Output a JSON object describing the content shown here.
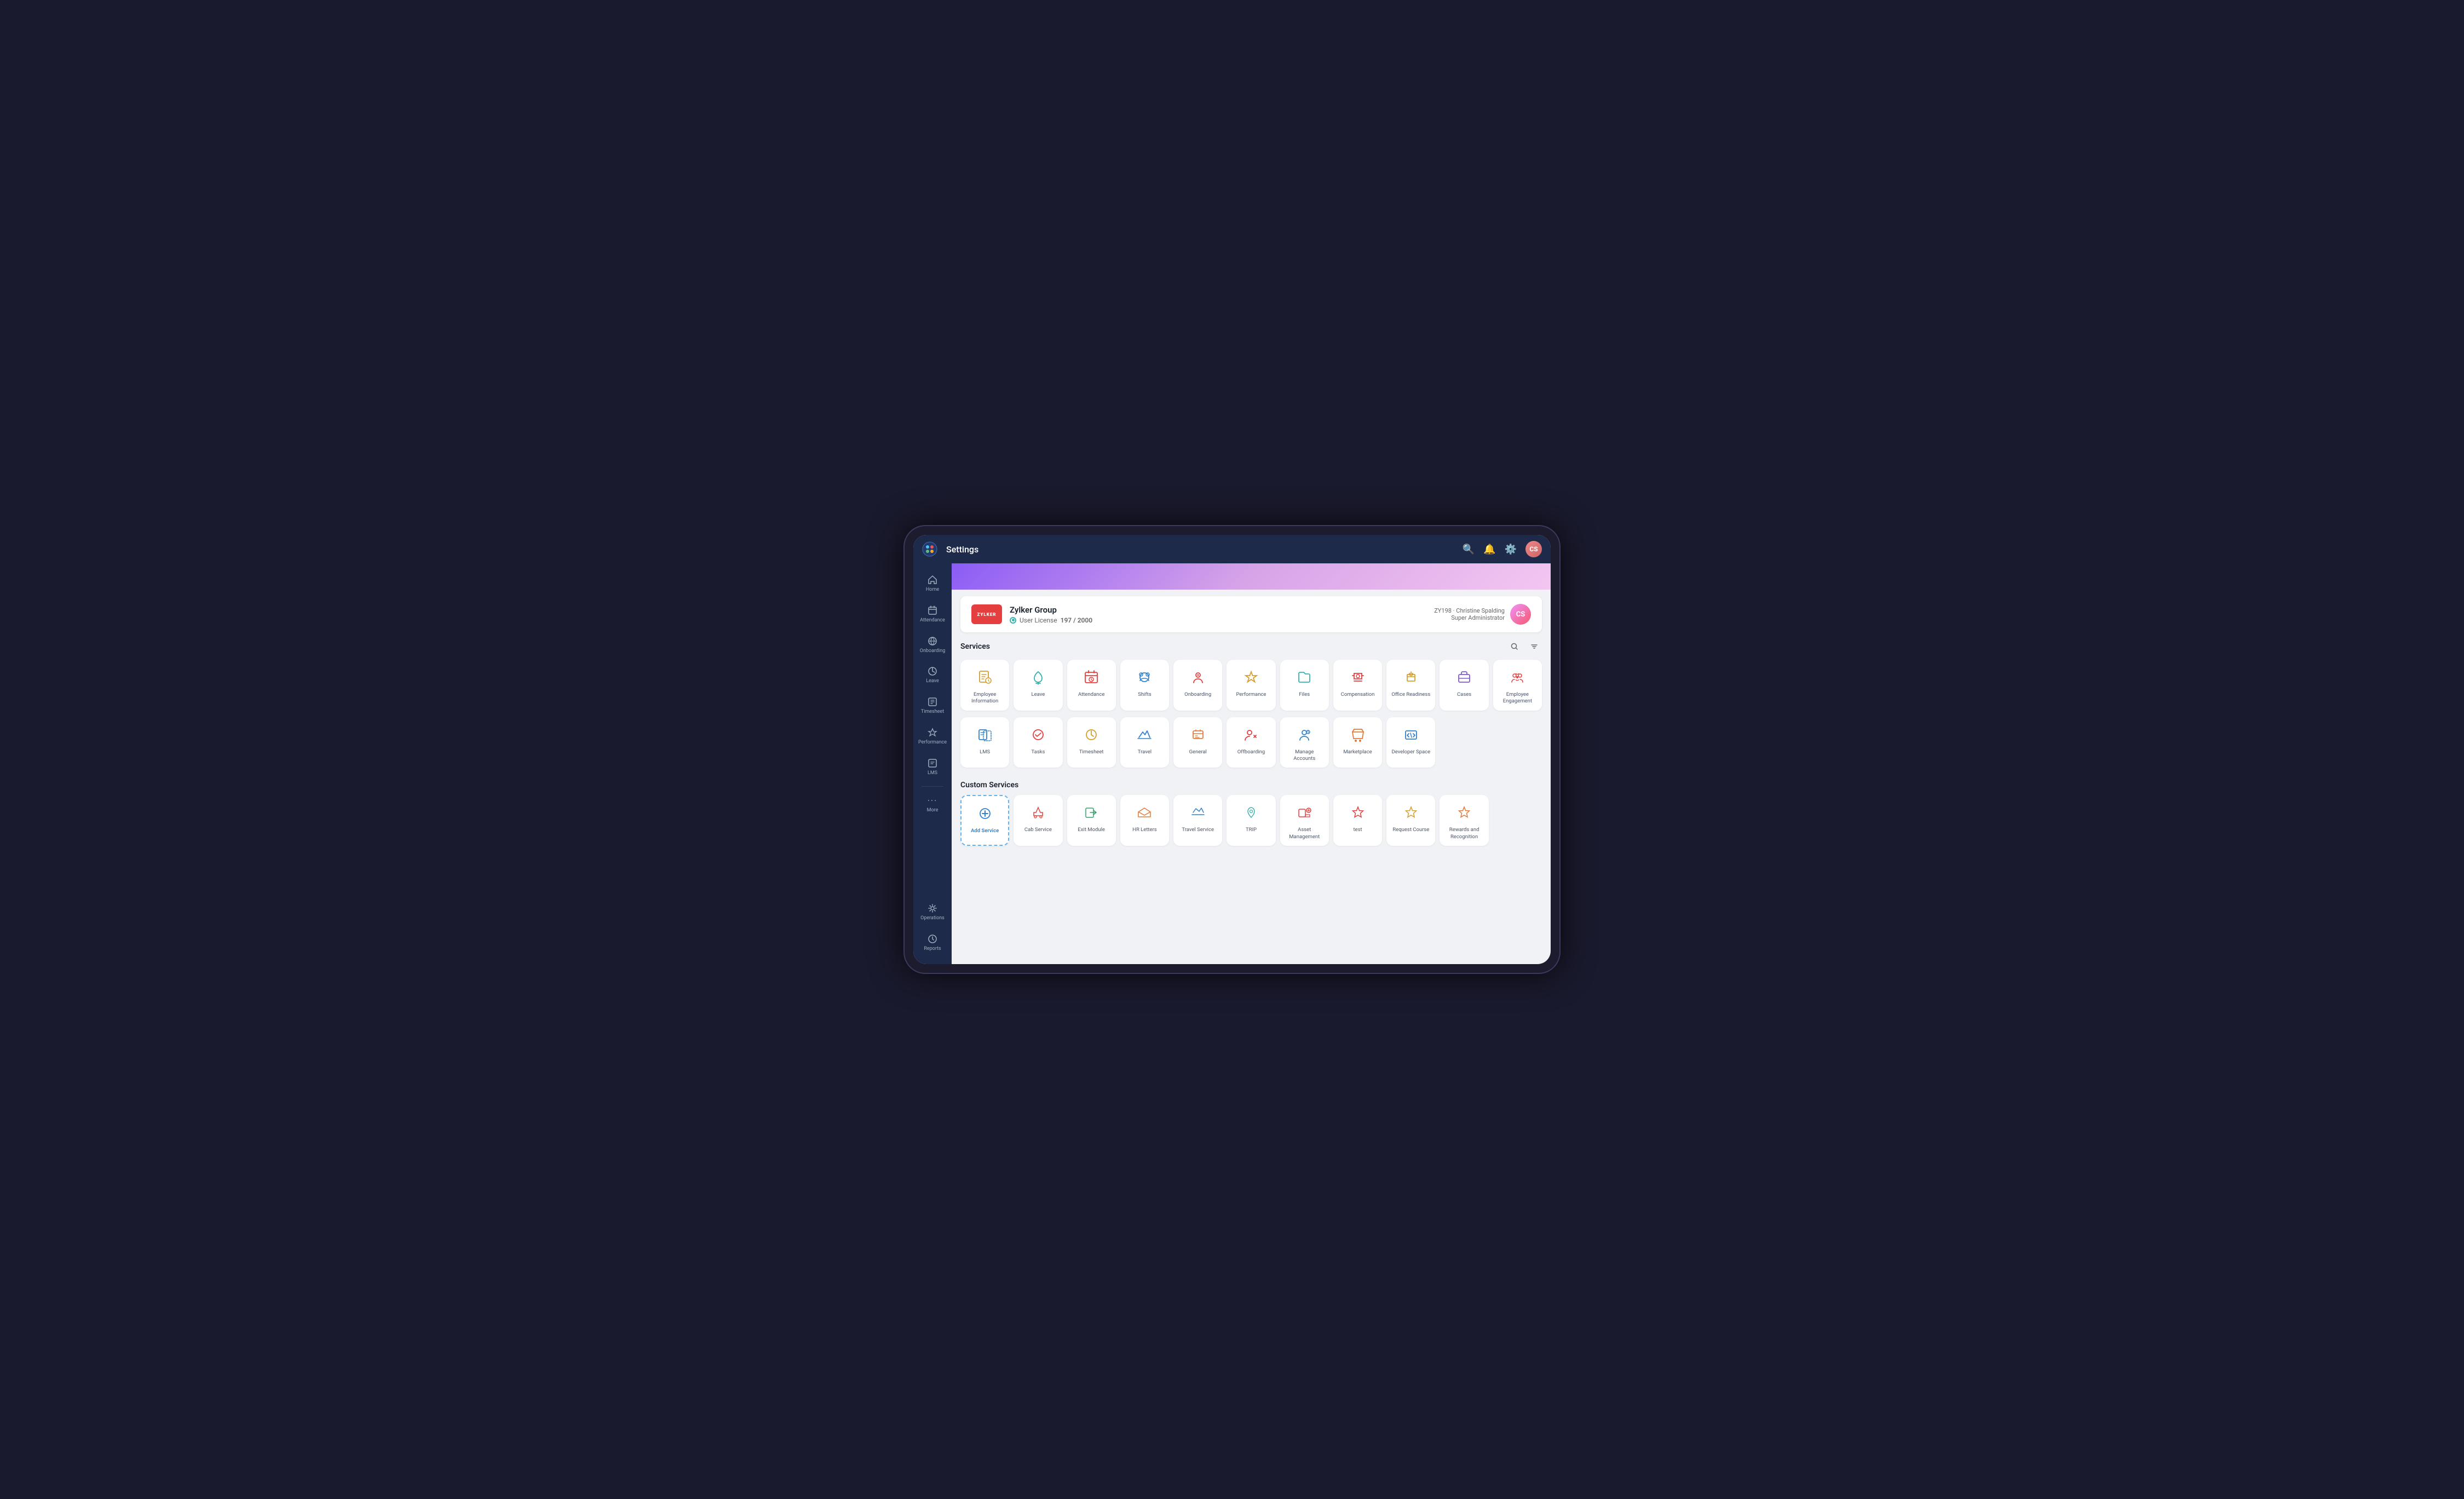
{
  "topBar": {
    "title": "Settings",
    "logoAlt": "Zoho People Logo"
  },
  "sidebar": {
    "items": [
      {
        "id": "home",
        "label": "Home",
        "icon": "🏠"
      },
      {
        "id": "attendance",
        "label": "Attendance",
        "icon": "📅"
      },
      {
        "id": "onboarding",
        "label": "Onboarding",
        "icon": "🌐"
      },
      {
        "id": "leave",
        "label": "Leave",
        "icon": "🌴"
      },
      {
        "id": "timesheet",
        "label": "Timesheet",
        "icon": "⏱"
      },
      {
        "id": "performance",
        "label": "Performance",
        "icon": "🏆"
      },
      {
        "id": "lms",
        "label": "LMS",
        "icon": "📋"
      },
      {
        "id": "more",
        "label": "More",
        "icon": "•••"
      },
      {
        "id": "operations",
        "label": "Operations",
        "icon": "⚙"
      },
      {
        "id": "reports",
        "label": "Reports",
        "icon": "🕐"
      }
    ]
  },
  "company": {
    "logo": "ZYLKER",
    "name": "Zylker Group",
    "license_label": "User License",
    "license_used": "197",
    "license_total": "2000"
  },
  "user": {
    "id": "ZY198",
    "name": "Christine Spalding",
    "role": "Super Administrator"
  },
  "services": {
    "section_title": "Services",
    "items": [
      {
        "id": "employee-information",
        "label": "Employee\nInformation",
        "color": "#d69e2e"
      },
      {
        "id": "leave",
        "label": "Leave",
        "color": "#38b2ac"
      },
      {
        "id": "attendance",
        "label": "Attendance",
        "color": "#e53e3e"
      },
      {
        "id": "shifts",
        "label": "Shifts",
        "color": "#3182ce"
      },
      {
        "id": "onboarding",
        "label": "Onboarding",
        "color": "#e53e3e"
      },
      {
        "id": "performance",
        "label": "Performance",
        "color": "#d69e2e"
      },
      {
        "id": "files",
        "label": "Files",
        "color": "#38b2ac"
      },
      {
        "id": "compensation",
        "label": "Compensation",
        "color": "#e53e3e"
      },
      {
        "id": "office-readiness",
        "label": "Office Readiness",
        "color": "#d69e2e"
      },
      {
        "id": "cases",
        "label": "Cases",
        "color": "#805ad5"
      },
      {
        "id": "employee-engagement",
        "label": "Employee\nEngagement",
        "color": "#e53e3e"
      },
      {
        "id": "lms",
        "label": "LMS",
        "color": "#3182ce"
      },
      {
        "id": "tasks",
        "label": "Tasks",
        "color": "#e53e3e"
      },
      {
        "id": "timesheet",
        "label": "Timesheet",
        "color": "#d69e2e"
      },
      {
        "id": "travel",
        "label": "Travel",
        "color": "#3182ce"
      },
      {
        "id": "general",
        "label": "General",
        "color": "#e07b39"
      },
      {
        "id": "offboarding",
        "label": "Offboarding",
        "color": "#e53e3e"
      },
      {
        "id": "manage-accounts",
        "label": "Manage Accounts",
        "color": "#3182ce"
      },
      {
        "id": "marketplace",
        "label": "Marketplace",
        "color": "#e07b39"
      },
      {
        "id": "developer-space",
        "label": "Developer Space",
        "color": "#3182ce"
      }
    ]
  },
  "customServices": {
    "section_title": "Custom Services",
    "add_label": "Add Service",
    "items": [
      {
        "id": "cab-service",
        "label": "Cab Service",
        "color": "#e53e3e"
      },
      {
        "id": "exit-module",
        "label": "Exit Module",
        "color": "#38a169"
      },
      {
        "id": "hr-letters",
        "label": "HR Letters",
        "color": "#e07b39"
      },
      {
        "id": "travel-service",
        "label": "Travel Service",
        "color": "#3182ce"
      },
      {
        "id": "trip",
        "label": "TRIP",
        "color": "#38b2ac"
      },
      {
        "id": "asset-management",
        "label": "Asset\nManagement",
        "color": "#e53e3e"
      },
      {
        "id": "test",
        "label": "test",
        "color": "#e53e3e"
      },
      {
        "id": "request-course",
        "label": "Request Course",
        "color": "#d69e2e"
      },
      {
        "id": "rewards-recognition",
        "label": "Rewards and\nRecognition",
        "color": "#e07b39"
      }
    ]
  }
}
